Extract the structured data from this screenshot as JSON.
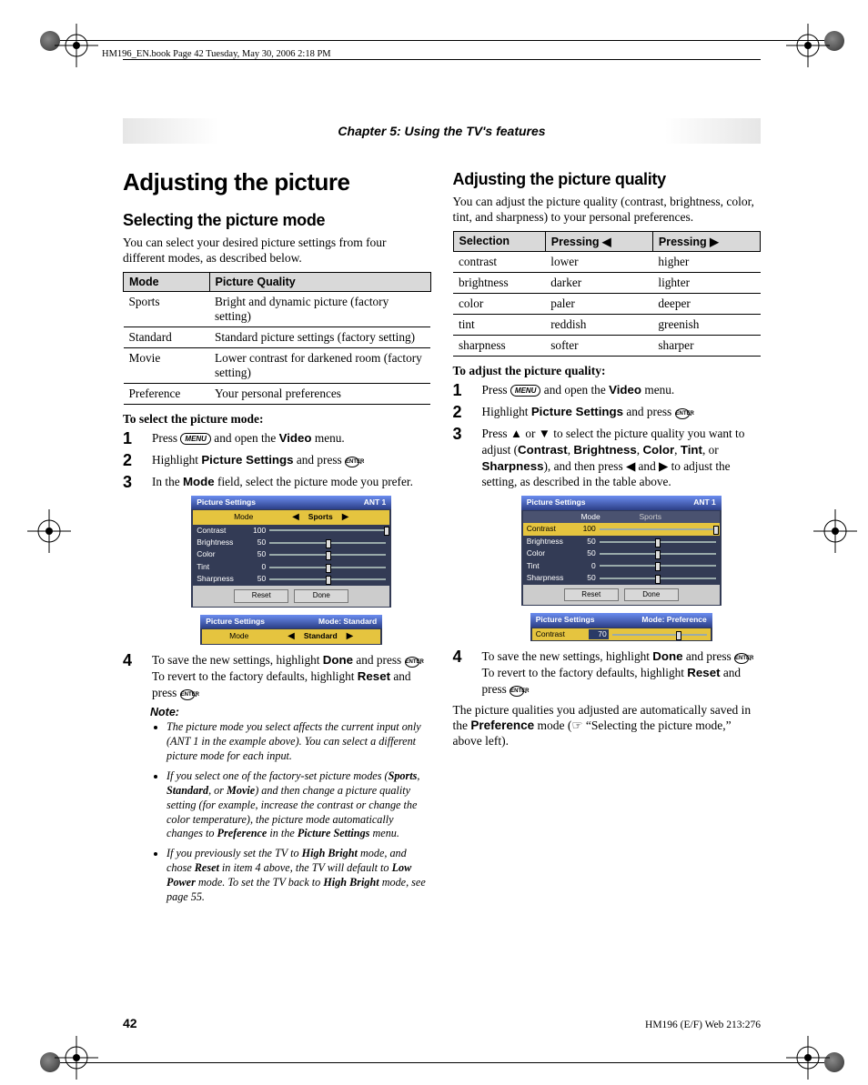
{
  "running_header": "HM196_EN.book  Page 42  Tuesday, May 30, 2006  2:18 PM",
  "chapter_banner": "Chapter 5: Using the TV's features",
  "page_number": "42",
  "footer_right": "HM196 (E/F) Web 213:276",
  "left": {
    "h1": "Adjusting the picture",
    "h2": "Selecting the picture mode",
    "intro": "You can select your desired picture settings from four different modes, as described below.",
    "modeTable": {
      "headers": [
        "Mode",
        "Picture Quality"
      ],
      "rows": [
        [
          "Sports",
          "Bright and dynamic picture (factory setting)"
        ],
        [
          "Standard",
          "Standard picture settings (factory setting)"
        ],
        [
          "Movie",
          "Lower contrast for darkened room (factory setting)"
        ],
        [
          "Preference",
          "Your personal preferences"
        ]
      ]
    },
    "procTitle": "To select the picture mode:",
    "steps": {
      "s1a": "Press ",
      "s1b": " and open the ",
      "s1c": "Video",
      "s1d": " menu.",
      "s2a": "Highlight ",
      "s2b": "Picture Settings",
      "s2c": " and press ",
      "s2d": ".",
      "s3a": "In the ",
      "s3b": "Mode",
      "s3c": " field, select the picture mode you prefer.",
      "s4a": "To save the new settings, highlight ",
      "s4b": "Done",
      "s4c": " and press ",
      "s4d": ". To revert to the factory defaults, highlight ",
      "s4e": "Reset",
      "s4f": " and press ",
      "s4g": "."
    },
    "osd1": {
      "title": "Picture Settings",
      "input": "ANT 1",
      "modeLabel": "Mode",
      "modeValue": "Sports",
      "rows": [
        {
          "label": "Contrast",
          "value": "100",
          "pos": 100
        },
        {
          "label": "Brightness",
          "value": "50",
          "pos": 50
        },
        {
          "label": "Color",
          "value": "50",
          "pos": 50
        },
        {
          "label": "Tint",
          "value": "0",
          "pos": 50
        },
        {
          "label": "Sharpness",
          "value": "50",
          "pos": 50
        }
      ],
      "reset": "Reset",
      "done": "Done"
    },
    "osd2": {
      "title": "Picture Settings",
      "right": "Mode: Standard",
      "modeLabel": "Mode",
      "modeValue": "Standard"
    },
    "noteTitle": "Note:",
    "notes": {
      "n1": "The picture mode you select affects the current input only (ANT 1 in the example above). You can select a different picture mode for each input.",
      "n2a": "If you select one of the factory-set picture modes (",
      "n2b": "Sports",
      "n2c": ", ",
      "n2d": "Standard",
      "n2e": ", or ",
      "n2f": "Movie",
      "n2g": ") and then change a picture quality setting (for example, increase the contrast or change the color temperature), the picture mode automatically changes to ",
      "n2h": "Preference",
      "n2i": " in the ",
      "n2j": "Picture Settings",
      "n2k": " menu.",
      "n3a": "If you previously set the TV to ",
      "n3b": "High Bright",
      "n3c": " mode, and chose ",
      "n3d": "Reset",
      "n3e": " in item 4 above, the TV will default to ",
      "n3f": "Low Power",
      "n3g": " mode. To set the TV back to ",
      "n3h": "High Bright",
      "n3i": " mode, see page 55."
    }
  },
  "right": {
    "h2": "Adjusting the picture quality",
    "intro": "You can adjust the picture quality (contrast, brightness, color, tint, and sharpness) to your personal preferences.",
    "selTable": {
      "headers": [
        "Selection",
        "Pressing ◀",
        "Pressing ▶"
      ],
      "rows": [
        [
          "contrast",
          "lower",
          "higher"
        ],
        [
          "brightness",
          "darker",
          "lighter"
        ],
        [
          "color",
          "paler",
          "deeper"
        ],
        [
          "tint",
          "reddish",
          "greenish"
        ],
        [
          "sharpness",
          "softer",
          "sharper"
        ]
      ]
    },
    "procTitle": "To adjust the picture quality:",
    "steps": {
      "s1a": "Press ",
      "s1b": " and open the ",
      "s1c": "Video",
      "s1d": " menu.",
      "s2a": "Highlight ",
      "s2b": "Picture Settings",
      "s2c": " and press ",
      "s2d": ".",
      "s3a": "Press ▲ or ▼ to select the picture quality you want to adjust (",
      "s3b": "Contrast",
      "s3c": ", ",
      "s3d": "Brightness",
      "s3e": ", ",
      "s3f": "Color",
      "s3g": ", ",
      "s3h": "Tint",
      "s3i": ", or ",
      "s3j": "Sharpness",
      "s3k": "), and then press ◀ and ▶ to adjust the setting, as described in the table above.",
      "s4a": "To save the new settings, highlight ",
      "s4b": "Done",
      "s4c": " and press ",
      "s4d": ". To revert to the factory defaults, highlight ",
      "s4e": "Reset",
      "s4f": " and press ",
      "s4g": "."
    },
    "osd1": {
      "title": "Picture Settings",
      "input": "ANT 1",
      "modeLabel": "Mode",
      "modeValue": "Sports",
      "rows": [
        {
          "label": "Contrast",
          "value": "100",
          "pos": 100,
          "hi": true
        },
        {
          "label": "Brightness",
          "value": "50",
          "pos": 50
        },
        {
          "label": "Color",
          "value": "50",
          "pos": 50
        },
        {
          "label": "Tint",
          "value": "0",
          "pos": 50
        },
        {
          "label": "Sharpness",
          "value": "50",
          "pos": 50
        }
      ],
      "reset": "Reset",
      "done": "Done"
    },
    "osd2": {
      "title": "Picture Settings",
      "right": "Mode: Preference",
      "rowLabel": "Contrast",
      "rowValue": "70",
      "rowPos": 70
    },
    "tail": {
      "a": "The picture qualities you adjusted are automatically saved in the ",
      "b": "Preference",
      "c": " mode (☞ “Selecting the picture mode,” above left)."
    }
  },
  "glyph": {
    "menu": "MENU",
    "enter": "ENTER"
  }
}
